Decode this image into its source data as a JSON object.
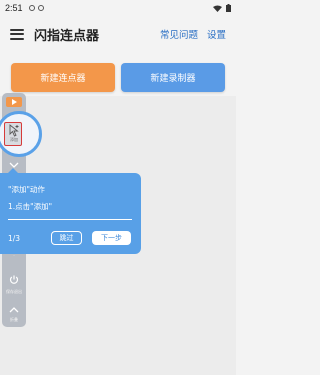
{
  "status_bar": {
    "time": "2:51"
  },
  "app_bar": {
    "title": "闪指连点器",
    "actions": [
      "常见问题",
      "设置"
    ]
  },
  "buttons": {
    "new_clicker": "新建连点器",
    "new_recorder": "新建录制器"
  },
  "toolbar": {
    "add_label": "添加",
    "save_exit_label": "保存退出",
    "collapse_label": "折叠"
  },
  "tooltip": {
    "title": "\"添加\"动作",
    "step": "1.点击\"添加\"",
    "counter": "1/3",
    "skip": "跳过",
    "next": "下一步"
  },
  "colors": {
    "accent_blue": "#5a9be6",
    "accent_orange": "#f3974a",
    "highlight_red": "#d63b3b"
  }
}
